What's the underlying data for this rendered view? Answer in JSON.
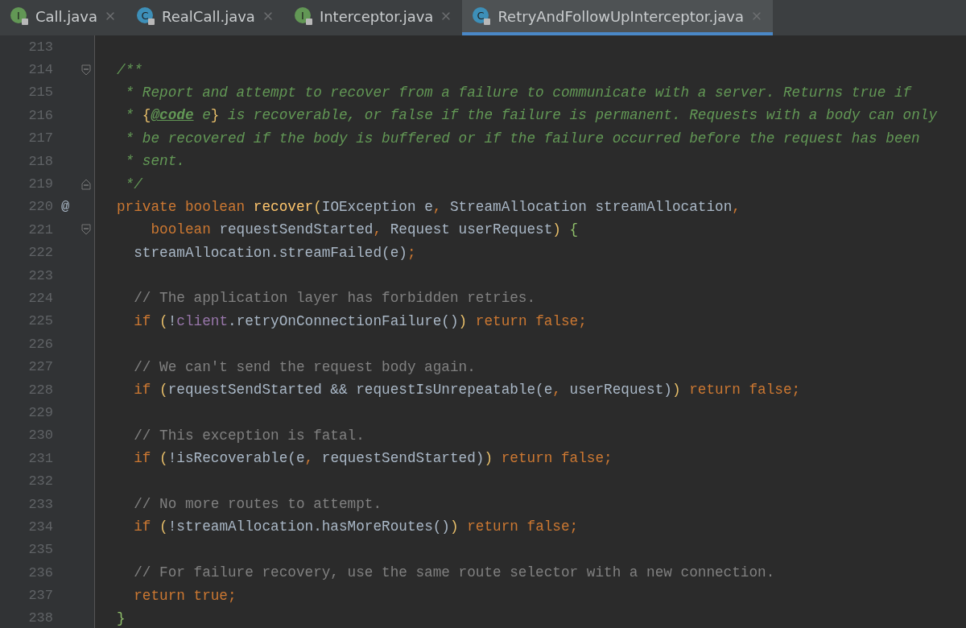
{
  "tabs": [
    {
      "label": "Call.java",
      "kind": "interface",
      "letter": "I",
      "selected": false
    },
    {
      "label": "RealCall.java",
      "kind": "class",
      "letter": "C",
      "selected": false
    },
    {
      "label": "Interceptor.java",
      "kind": "interface",
      "letter": "I",
      "selected": false
    },
    {
      "label": "RetryAndFollowUpInterceptor.java",
      "kind": "class",
      "letter": "C",
      "selected": true
    }
  ],
  "lines": [
    {
      "number": "213"
    },
    {
      "number": "214",
      "kind": "fold-start",
      "tokens": [
        {
          "kind": "doc",
          "text": "/**"
        }
      ]
    },
    {
      "number": "215",
      "tokens": [
        {
          "kind": "doc",
          "text": " * Report and attempt to recover from a failure to communicate with a server. Returns true if"
        }
      ]
    },
    {
      "number": "216",
      "tokens": [
        {
          "kind": "doc",
          "text": " * "
        },
        {
          "kind": "brace",
          "text": "{"
        },
        {
          "kind": "tag",
          "text": "@code"
        },
        {
          "kind": "doc",
          "text": " e"
        },
        {
          "kind": "brace",
          "text": "}"
        },
        {
          "kind": "doc",
          "text": " is recoverable, or false if the failure is permanent. Requests with a body can only"
        }
      ]
    },
    {
      "number": "217",
      "tokens": [
        {
          "kind": "doc",
          "text": " * be recovered if the body is buffered or if the failure occurred before the request has been"
        }
      ]
    },
    {
      "number": "218",
      "tokens": [
        {
          "kind": "doc",
          "text": " * sent."
        }
      ]
    },
    {
      "number": "219",
      "kind": "fold-end",
      "tokens": [
        {
          "kind": "doc",
          "text": " */"
        }
      ]
    },
    {
      "number": "220",
      "gutter_mark": "@",
      "tokens": [
        {
          "kind": "keyword",
          "text": "private boolean "
        },
        {
          "kind": "function",
          "text": "recover"
        },
        {
          "kind": "brace",
          "text": "("
        },
        {
          "kind": "plain",
          "text": "IOException e"
        },
        {
          "kind": "keyword",
          "text": ", "
        },
        {
          "kind": "plain",
          "text": "StreamAllocation streamAllocation"
        },
        {
          "kind": "keyword",
          "text": ","
        }
      ]
    },
    {
      "number": "221",
      "kind": "fold-start",
      "tokens": [
        {
          "kind": "keyword",
          "text": "    boolean "
        },
        {
          "kind": "plain",
          "text": "requestSendStarted"
        },
        {
          "kind": "keyword",
          "text": ", "
        },
        {
          "kind": "plain",
          "text": "Request userRequest"
        },
        {
          "kind": "brace",
          "text": ")"
        },
        {
          "kind": "block",
          "text": " {"
        }
      ]
    },
    {
      "number": "222",
      "tokens": [
        {
          "kind": "plain",
          "text": "  streamAllocation.streamFailed(e)"
        },
        {
          "kind": "keyword",
          "text": ";"
        }
      ]
    },
    {
      "number": "223"
    },
    {
      "number": "224",
      "tokens": [
        {
          "kind": "comment",
          "text": "  // The application layer has forbidden retries."
        }
      ]
    },
    {
      "number": "225",
      "tokens": [
        {
          "kind": "keyword",
          "text": "  if "
        },
        {
          "kind": "brace",
          "text": "("
        },
        {
          "kind": "plain",
          "text": "!"
        },
        {
          "kind": "field",
          "text": "client"
        },
        {
          "kind": "plain",
          "text": ".retryOnConnectionFailure()"
        },
        {
          "kind": "brace",
          "text": ")"
        },
        {
          "kind": "keyword",
          "text": " return false;"
        }
      ]
    },
    {
      "number": "226"
    },
    {
      "number": "227",
      "tokens": [
        {
          "kind": "comment",
          "text": "  // We can't send the request body again."
        }
      ]
    },
    {
      "number": "228",
      "tokens": [
        {
          "kind": "keyword",
          "text": "  if "
        },
        {
          "kind": "brace",
          "text": "("
        },
        {
          "kind": "plain",
          "text": "requestSendStarted && requestIsUnrepeatable(e"
        },
        {
          "kind": "keyword",
          "text": ", "
        },
        {
          "kind": "plain",
          "text": "userRequest)"
        },
        {
          "kind": "brace",
          "text": ")"
        },
        {
          "kind": "keyword",
          "text": " return false;"
        }
      ]
    },
    {
      "number": "229"
    },
    {
      "number": "230",
      "tokens": [
        {
          "kind": "comment",
          "text": "  // This exception is fatal."
        }
      ]
    },
    {
      "number": "231",
      "tokens": [
        {
          "kind": "keyword",
          "text": "  if "
        },
        {
          "kind": "brace",
          "text": "("
        },
        {
          "kind": "plain",
          "text": "!isRecoverable(e"
        },
        {
          "kind": "keyword",
          "text": ", "
        },
        {
          "kind": "plain",
          "text": "requestSendStarted)"
        },
        {
          "kind": "brace",
          "text": ")"
        },
        {
          "kind": "keyword",
          "text": " return false;"
        }
      ]
    },
    {
      "number": "232"
    },
    {
      "number": "233",
      "tokens": [
        {
          "kind": "comment",
          "text": "  // No more routes to attempt."
        }
      ]
    },
    {
      "number": "234",
      "tokens": [
        {
          "kind": "keyword",
          "text": "  if "
        },
        {
          "kind": "brace",
          "text": "("
        },
        {
          "kind": "plain",
          "text": "!streamAllocation.hasMoreRoutes()"
        },
        {
          "kind": "brace",
          "text": ")"
        },
        {
          "kind": "keyword",
          "text": " return false;"
        }
      ]
    },
    {
      "number": "235"
    },
    {
      "number": "236",
      "tokens": [
        {
          "kind": "comment",
          "text": "  // For failure recovery, use the same route selector with a new connection."
        }
      ]
    },
    {
      "number": "237",
      "tokens": [
        {
          "kind": "keyword",
          "text": "  return true;"
        }
      ]
    },
    {
      "number": "238",
      "tokens": [
        {
          "kind": "block",
          "text": "}"
        }
      ]
    }
  ]
}
